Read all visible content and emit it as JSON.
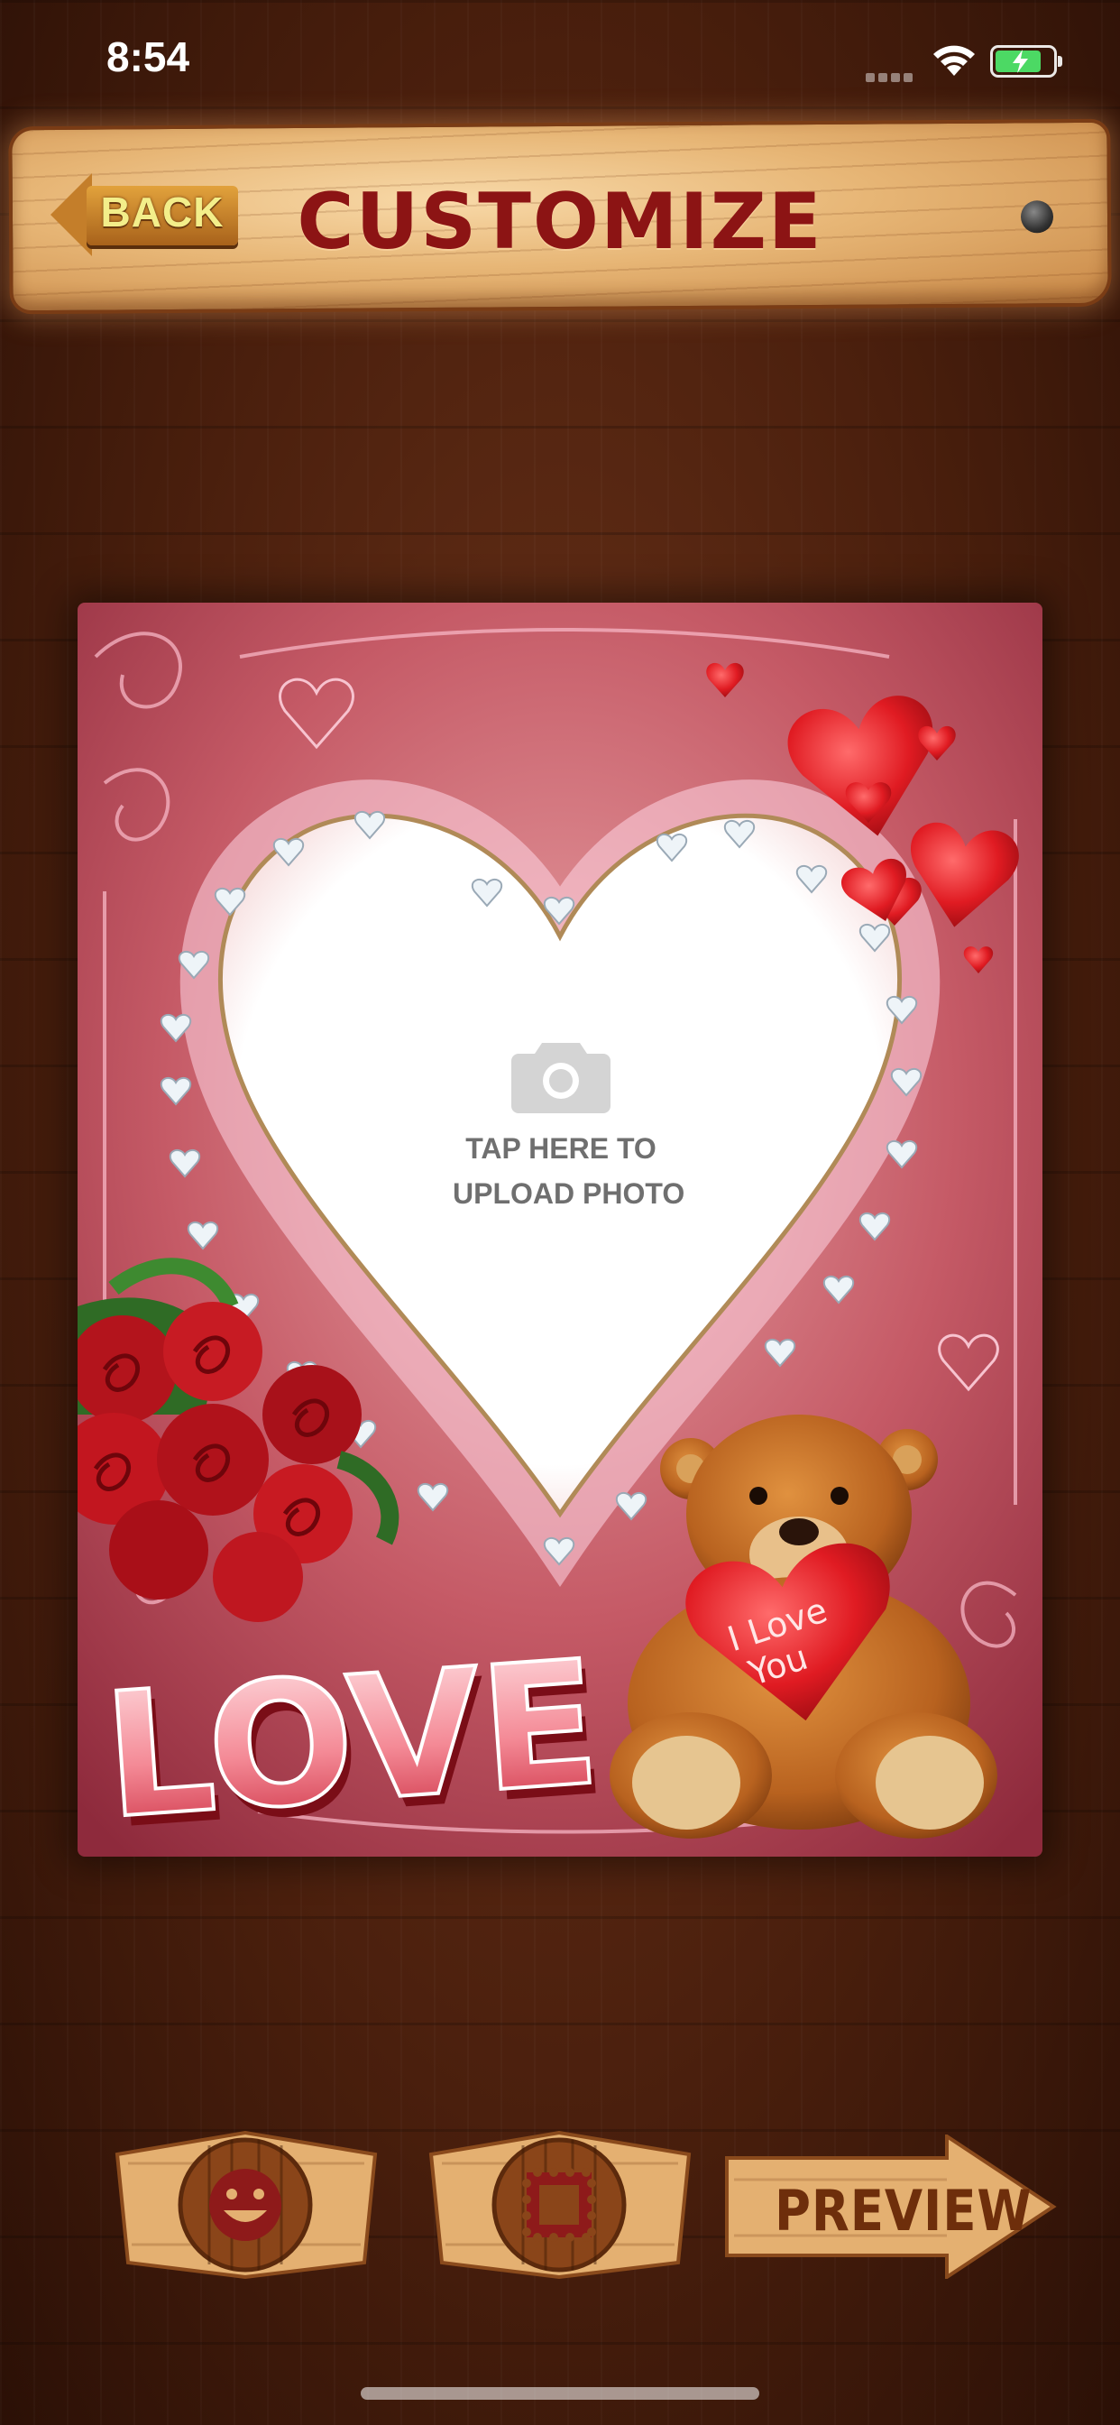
{
  "status_bar": {
    "time": "8:54"
  },
  "header": {
    "back_label": "BACK",
    "title": "CUSTOMIZE"
  },
  "frame": {
    "upload_text_line1": "TAP HERE TO",
    "upload_text_line2": "UPLOAD PHOTO",
    "love_text": "LOVE",
    "bear_heart_text_line1": "I Love",
    "bear_heart_text_line2": "You"
  },
  "toolbar": {
    "sticker_icon": "smiley-icon",
    "frame_icon": "stamp-frame-icon",
    "preview_label": "PREVIEW"
  },
  "colors": {
    "wood_dark": "#4a1f0d",
    "plank": "#e7b676",
    "title": "#8c1414",
    "back_text": "#f3ee8a"
  }
}
